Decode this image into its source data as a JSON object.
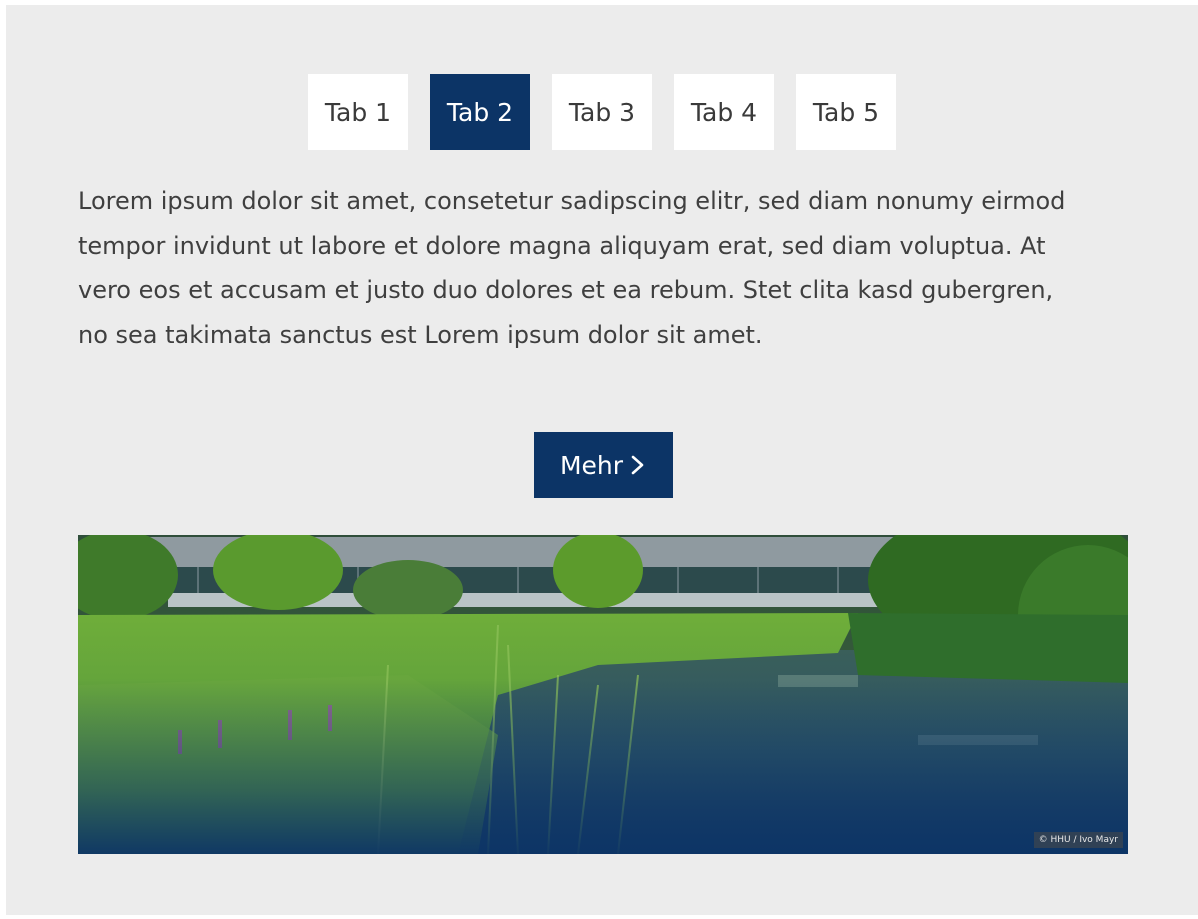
{
  "tabs": [
    {
      "label": "Tab 1",
      "active": false
    },
    {
      "label": "Tab 2",
      "active": true
    },
    {
      "label": "Tab 3",
      "active": false
    },
    {
      "label": "Tab 4",
      "active": false
    },
    {
      "label": "Tab 5",
      "active": false
    }
  ],
  "content": {
    "text": "Lorem ipsum dolor sit amet, consetetur sadipscing elitr, sed diam nonumy eirmod tempor invidunt ut labore et dolore magna aliquyam erat, sed diam voluptua. At vero eos et accusam et justo duo dolores et ea rebum. Stet clita kasd gubergren, no sea takimata sanctus est Lorem ipsum dolor sit amet.",
    "button_label": "Mehr",
    "button_icon": "chevron-right-icon"
  },
  "image": {
    "credit": "© HHU / Ivo Mayr"
  },
  "colors": {
    "accent": "#0c3466",
    "background": "#ececec",
    "tab_bg": "#ffffff"
  }
}
